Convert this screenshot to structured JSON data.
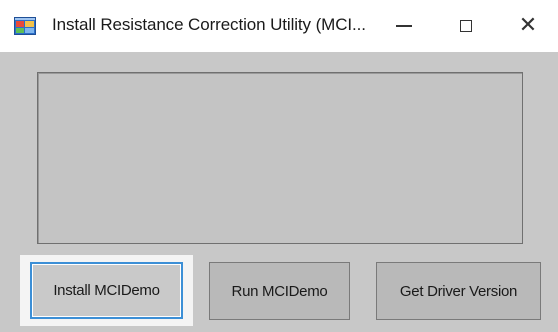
{
  "window": {
    "title": "Install Resistance Correction Utility (MCI...",
    "icons": {
      "app": "application-window-icon",
      "minimize": "minimize-icon",
      "maximize": "maximize-icon",
      "close": "close-icon"
    },
    "close_glyph": "✕"
  },
  "output": {
    "text": ""
  },
  "buttons": {
    "install": "Install MCIDemo",
    "run": "Run MCIDemo",
    "driver_version": "Get Driver Version"
  },
  "colors": {
    "accent_focus": "#3c8fd6",
    "client_background": "#c8c8c8",
    "button_face": "#b9b9b9"
  }
}
